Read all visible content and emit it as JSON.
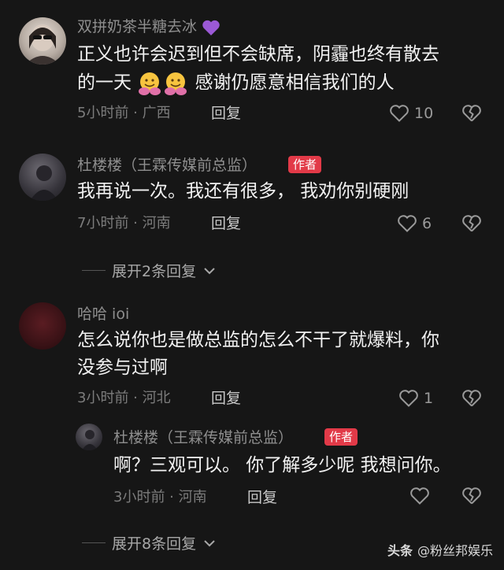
{
  "comments": [
    {
      "username": "双拼奶茶半糖去冰",
      "text_line1": "正义也许会迟到但不会缺席，阴霾也终有散去",
      "text_line2_a": "的一天",
      "text_line2_b": "感谢仍愿意相信我们的人",
      "meta": "5小时前 · 广西",
      "reply_label": "回复",
      "likes": "10"
    },
    {
      "username": "杜楼楼（王霖传媒前总监）",
      "author_tag": "作者",
      "text_line1": "我再说一次。我还有很多，  我劝你别硬刚",
      "meta": "7小时前 · 河南",
      "reply_label": "回复",
      "likes": "6",
      "expand_label": "展开2条回复"
    },
    {
      "username": "哈哈 ioi",
      "text_line1": "怎么说你也是做总监的怎么不干了就爆料，你",
      "text_line2": "没参与过啊",
      "meta": "3小时前 · 河北",
      "reply_label": "回复",
      "likes": "1"
    },
    {
      "username": "杜楼楼（王霖传媒前总监）",
      "author_tag": "作者",
      "text_line1": "啊？三观可以。 你了解多少呢 我想问你。",
      "meta": "3小时前 · 河南",
      "reply_label": "回复",
      "expand_label": "展开8条回复"
    }
  ],
  "footer": {
    "brand": "头条",
    "handle": "@粉丝邦娱乐"
  },
  "colors": {
    "background": "#161616",
    "author_tag": "#e23a48",
    "heart_emoji": "#9b59d6"
  }
}
